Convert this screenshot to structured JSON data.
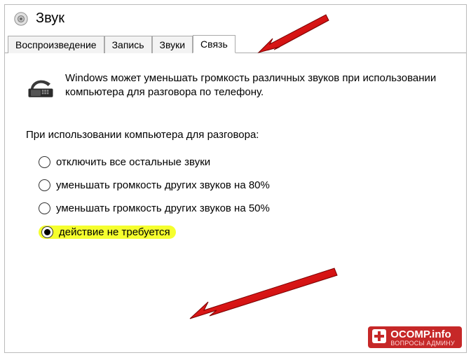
{
  "window": {
    "title": "Звук"
  },
  "tabs": [
    {
      "label": "Воспроизведение"
    },
    {
      "label": "Запись"
    },
    {
      "label": "Звуки"
    },
    {
      "label": "Связь",
      "active": true
    }
  ],
  "description": "Windows может уменьшать громкость различных звуков при использовании компьютера для разговора по телефону.",
  "subheading": "При использовании компьютера для разговора:",
  "options": [
    {
      "label": "отключить все остальные звуки",
      "checked": false
    },
    {
      "label": "уменьшать громкость других звуков на 80%",
      "checked": false
    },
    {
      "label": "уменьшать громкость других звуков на 50%",
      "checked": false
    },
    {
      "label": "действие не требуется",
      "checked": true,
      "highlight": true
    }
  ],
  "watermark": {
    "main": "OCOMP.info",
    "sub": "ВОПРОСЫ АДМИНУ"
  }
}
